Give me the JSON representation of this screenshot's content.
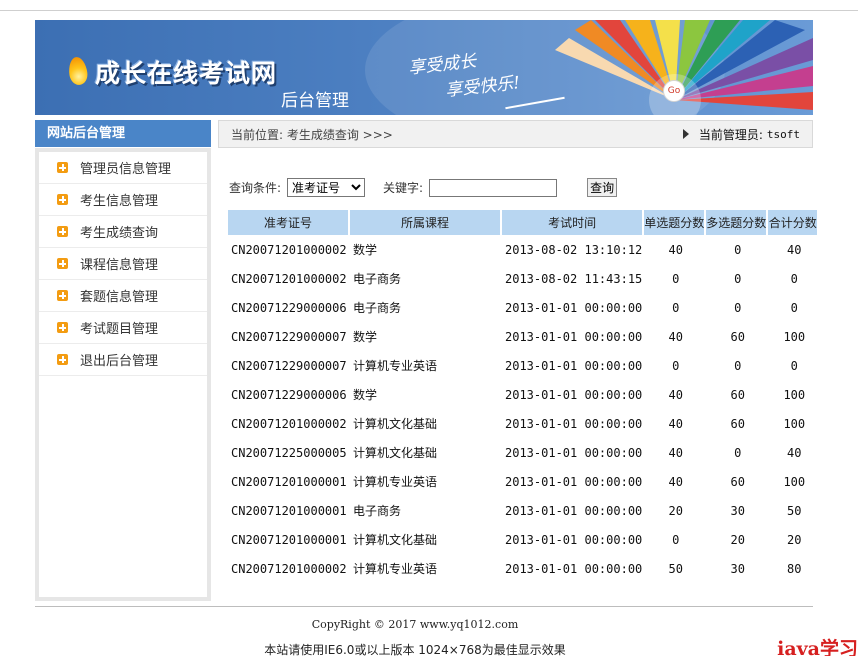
{
  "banner": {
    "site_name": "成长在线考试网",
    "subtitle": "后台管理",
    "slogan_line1": "享受成长",
    "slogan_line2": "享受快乐!",
    "go_label": "Go"
  },
  "sidebar": {
    "title": "网站后台管理",
    "items": [
      {
        "label": "管理员信息管理"
      },
      {
        "label": "考生信息管理"
      },
      {
        "label": "考生成绩查询"
      },
      {
        "label": "课程信息管理"
      },
      {
        "label": "套题信息管理"
      },
      {
        "label": "考试题目管理"
      },
      {
        "label": "退出后台管理"
      }
    ]
  },
  "location": {
    "text": "当前位置: 考生成绩查询 >>>",
    "admin_label": "当前管理员:",
    "admin_name": "tsoft"
  },
  "search": {
    "condition_label": "查询条件:",
    "selected_option": "准考证号",
    "keyword_label": "关键字:",
    "keyword_value": "",
    "button_label": "查询"
  },
  "table": {
    "headers": [
      "准考证号",
      "所属课程",
      "考试时间",
      "单选题分数",
      "多选题分数",
      "合计分数"
    ],
    "rows": [
      [
        "CN20071201000002",
        "数学",
        "2013-08-02 13:10:12",
        "40",
        "0",
        "40"
      ],
      [
        "CN20071201000002",
        "电子商务",
        "2013-08-02 11:43:15",
        "0",
        "0",
        "0"
      ],
      [
        "CN20071229000006",
        "电子商务",
        "2013-01-01 00:00:00",
        "0",
        "0",
        "0"
      ],
      [
        "CN20071229000007",
        "数学",
        "2013-01-01 00:00:00",
        "40",
        "60",
        "100"
      ],
      [
        "CN20071229000007",
        "计算机专业英语",
        "2013-01-01 00:00:00",
        "0",
        "0",
        "0"
      ],
      [
        "CN20071229000006",
        "数学",
        "2013-01-01 00:00:00",
        "40",
        "60",
        "100"
      ],
      [
        "CN20071201000002",
        "计算机文化基础",
        "2013-01-01 00:00:00",
        "40",
        "60",
        "100"
      ],
      [
        "CN20071225000005",
        "计算机文化基础",
        "2013-01-01 00:00:00",
        "40",
        "0",
        "40"
      ],
      [
        "CN20071201000001",
        "计算机专业英语",
        "2013-01-01 00:00:00",
        "40",
        "60",
        "100"
      ],
      [
        "CN20071201000001",
        "电子商务",
        "2013-01-01 00:00:00",
        "20",
        "30",
        "50"
      ],
      [
        "CN20071201000001",
        "计算机文化基础",
        "2013-01-01 00:00:00",
        "0",
        "20",
        "20"
      ],
      [
        "CN20071201000002",
        "计算机专业英语",
        "2013-01-01 00:00:00",
        "50",
        "30",
        "80"
      ]
    ]
  },
  "footer": {
    "copyright": "CopyRight © 2017 www.yq1012.com",
    "resolution_note": "本站请使用IE6.0或以上版本 1024×768为最佳显示效果",
    "watermark": "iava学习"
  },
  "colors": {
    "banner_blue": "#4d80c2",
    "sidebar_head": "#4a85c8",
    "table_header": "#b8d6f1",
    "menu_icon": "#f39c12",
    "watermark_red": "#d62020"
  }
}
